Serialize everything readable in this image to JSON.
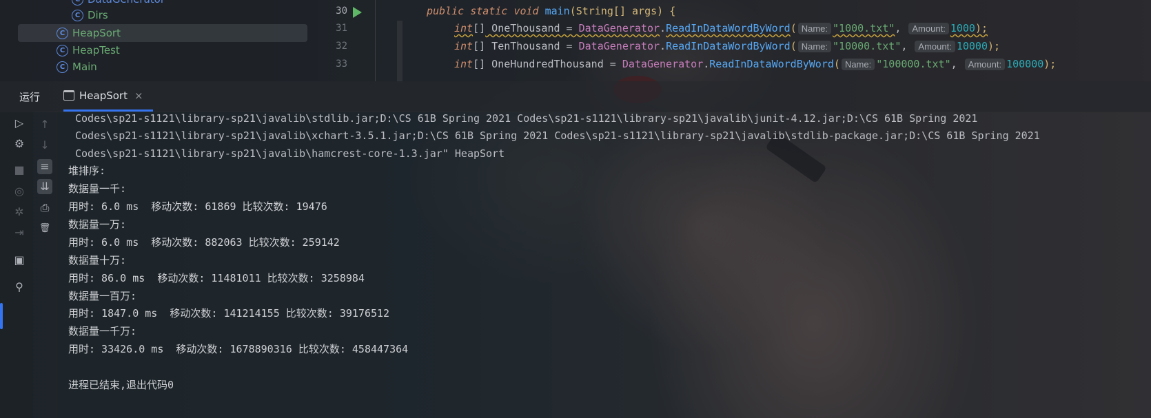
{
  "project_tree": {
    "items": [
      {
        "label": "DataGenerator"
      },
      {
        "label": "Dirs"
      },
      {
        "label": "HeapSort"
      },
      {
        "label": "HeapTest"
      },
      {
        "label": "Main"
      }
    ],
    "class_icon_glyph": "C"
  },
  "editor": {
    "lines": [
      {
        "number": "30"
      },
      {
        "number": "31"
      },
      {
        "number": "32"
      },
      {
        "number": "33"
      }
    ],
    "code": {
      "l30_public": "public",
      "l30_static": "static",
      "l30_void": "void",
      "l30_main": "main",
      "l30_params": "(String[] args) {",
      "type_int": "int",
      "brackets": "[]",
      "var1": " OneThousand = ",
      "var2": " TenThousand = ",
      "var3": " OneHundredThousand = ",
      "class_name": "DataGenerator",
      "dot": ".",
      "method": "ReadInDataWordByWord",
      "open_paren": "(",
      "hint_name": "Name:",
      "hint_amount": "Amount:",
      "str1": "\"1000.txt\"",
      "str2": "\"10000.txt\"",
      "str3": "\"100000.txt\"",
      "comma": ",",
      "num1": "1000",
      "num2": "10000",
      "num3": "100000",
      "close": ");"
    }
  },
  "run_panel": {
    "title": "运行",
    "tab_label": "HeapSort",
    "tab_close": "×"
  },
  "console": {
    "lines": [
      "Codes\\sp21-s1121\\library-sp21\\javalib\\stdlib.jar;D:\\CS 61B Spring 2021 Codes\\sp21-s1121\\library-sp21\\javalib\\junit-4.12.jar;D:\\CS 61B Spring 2021",
      "Codes\\sp21-s1121\\library-sp21\\javalib\\xchart-3.5.1.jar;D:\\CS 61B Spring 2021 Codes\\sp21-s1121\\library-sp21\\javalib\\stdlib-package.jar;D:\\CS 61B Spring 2021",
      "Codes\\sp21-s1121\\library-sp21\\javalib\\hamcrest-core-1.3.jar\" HeapSort",
      "堆排序:",
      "数据量一千:",
      "用时: 6.0 ms  移动次数: 61869 比较次数: 19476",
      "数据量一万:",
      "用时: 6.0 ms  移动次数: 882063 比较次数: 259142",
      "数据量十万:",
      "用时: 86.0 ms  移动次数: 11481011 比较次数: 3258984",
      "数据量一百万:",
      "用时: 1847.0 ms  移动次数: 141214155 比较次数: 39176512",
      "数据量一千万:",
      "用时: 33426.0 ms  移动次数: 1678890316 比较次数: 458447364",
      "",
      "进程已结束,退出代码0"
    ]
  },
  "toolbar": {
    "rerun": "▷",
    "settings": "⚙",
    "stop": "■",
    "camera": "◎",
    "debug": "✲",
    "exit": "⇥",
    "layout": "▣",
    "pin": "⚲",
    "up": "↑",
    "down": "↓",
    "wrap": "≡",
    "scroll_end": "⇊",
    "print": "⎙",
    "trash": "🗑"
  },
  "colors": {
    "keyword": "#cf8e6d",
    "method": "#56a8f5",
    "string": "#6aab73",
    "number": "#2aacb8",
    "accent": "#3574f0",
    "run_green": "#5fb865"
  }
}
